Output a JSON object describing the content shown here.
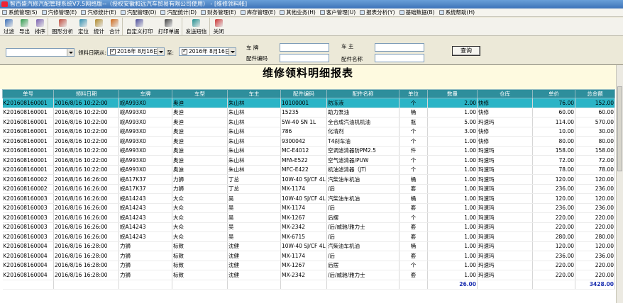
{
  "window": {
    "title": "智百盛汽修汽配管理系统V7.5网络版--（授权安徽和远汽车贸易有限公司使用） - [维修领料帐]"
  },
  "menu": [
    "系统管理(S)",
    "汽修管理(E)",
    "汽修统计(E)",
    "汽配管理(D)",
    "汽配统计(D)",
    "财务管理(E)",
    "库存管理(E)",
    "其他业务(H)",
    "客户管理(U)",
    "报表分析(Y)",
    "基础数据(B)",
    "系统帮助(H)"
  ],
  "toolbar": [
    {
      "label": "过滤",
      "icon": "filter-icon"
    },
    {
      "label": "导出",
      "icon": "export-icon"
    },
    {
      "label": "排序",
      "icon": "sort-icon"
    },
    {
      "label": "图形分析",
      "icon": "chart-icon"
    },
    {
      "label": "定位",
      "icon": "locate-icon"
    },
    {
      "label": "统计",
      "icon": "stats-icon"
    },
    {
      "label": "合计",
      "icon": "sum-icon"
    },
    {
      "label": "自定义打印",
      "icon": "custom-print-icon"
    },
    {
      "label": "打印单据",
      "icon": "print-icon"
    },
    {
      "label": "发送短信",
      "icon": "sms-icon"
    },
    {
      "label": "关闭",
      "icon": "close-icon"
    }
  ],
  "filter": {
    "combo1_value": "",
    "date_label_from": "领料日期从:",
    "date_from": "2016年 8月16日",
    "date_label_to": "至:",
    "date_to": "2016年 8月16日",
    "plate_label": "车  牌",
    "part_code_label": "配件编码",
    "owner_label": "车  主",
    "part_name_label": "配件名称",
    "query_button": "查询"
  },
  "report": {
    "title": "维修领料明细报表",
    "columns": [
      "单号",
      "领料日期",
      "车牌",
      "车型",
      "车主",
      "配件编码",
      "配件名称",
      "单位",
      "数量",
      "仓库",
      "单价",
      "总金额"
    ],
    "rows": [
      [
        "K201608160001",
        "2016/8/16  10:22:00",
        "皖A993X0",
        "奥迪",
        "朱山林",
        "10100001",
        "防冻液",
        "个",
        "2.00",
        "快修",
        "76.00",
        "152.00"
      ],
      [
        "K201608160001",
        "2016/8/16  10:22:00",
        "皖A993X0",
        "奥迪",
        "朱山林",
        "15235",
        "助力泵油",
        "桶",
        "1.00",
        "快修",
        "60.00",
        "60.00"
      ],
      [
        "K201608160001",
        "2016/8/16  10:22:00",
        "皖A993X0",
        "奥迪",
        "朱山林",
        "5W-40 SN 1L",
        "全合成汽油机机油",
        "瓶",
        "5.00",
        "玛速玛",
        "114.00",
        "570.00"
      ],
      [
        "K201608160001",
        "2016/8/16  10:22:00",
        "皖A993X0",
        "奥迪",
        "朱山林",
        "786",
        "化清剂",
        "个",
        "3.00",
        "快修",
        "10.00",
        "30.00"
      ],
      [
        "K201608160001",
        "2016/8/16  10:22:00",
        "皖A993X0",
        "奥迪",
        "朱山林",
        "9300042",
        "T4刹车油",
        "个",
        "1.00",
        "快修",
        "80.00",
        "80.00"
      ],
      [
        "K201608160001",
        "2016/8/16  10:22:00",
        "皖A993X0",
        "奥迪",
        "朱山林",
        "MC-E4012",
        "空调滤清器防PM2.5",
        "件",
        "1.00",
        "玛速玛",
        "158.00",
        "158.00"
      ],
      [
        "K201608160001",
        "2016/8/16  10:22:00",
        "皖A993X0",
        "奥迪",
        "朱山林",
        "MFA-E522",
        "空气滤清器/PUW",
        "个",
        "1.00",
        "玛速玛",
        "72.00",
        "72.00"
      ],
      [
        "K201608160001",
        "2016/8/16  10:22:00",
        "皖A993X0",
        "奥迪",
        "朱山林",
        "MFC-E422",
        "机油滤清器（JT）",
        "个",
        "1.00",
        "玛速玛",
        "78.00",
        "78.00"
      ],
      [
        "K201608160002",
        "2016/8/16  16:26:00",
        "皖A17K37",
        "力狮",
        "丁总",
        "10W-40 SJ/CF 4L",
        "汽柴油车机油",
        "桶",
        "1.00",
        "玛速玛",
        "120.00",
        "120.00"
      ],
      [
        "K201608160002",
        "2016/8/16  16:26:00",
        "皖A17K37",
        "力狮",
        "丁总",
        "MX-1174",
        "/后",
        "套",
        "1.00",
        "玛速玛",
        "236.00",
        "236.00"
      ],
      [
        "K201608160003",
        "2016/8/16  16:26:00",
        "皖A14243",
        "大众",
        "吴",
        "10W-40 SJ/CF 4L",
        "汽柴油车机油",
        "桶",
        "1.00",
        "玛速玛",
        "120.00",
        "120.00"
      ],
      [
        "K201608160003",
        "2016/8/16  16:26:00",
        "皖A14243",
        "大众",
        "吴",
        "MX-1174",
        "/后",
        "套",
        "1.00",
        "玛速玛",
        "236.00",
        "236.00"
      ],
      [
        "K201608160003",
        "2016/8/16  16:26:00",
        "皖A14243",
        "大众",
        "吴",
        "MX-1267",
        "后摆",
        "个",
        "1.00",
        "玛速玛",
        "220.00",
        "220.00"
      ],
      [
        "K201608160003",
        "2016/8/16  16:26:00",
        "皖A14243",
        "大众",
        "吴",
        "MX-2342",
        "/后/威驰/雅力士",
        "套",
        "1.00",
        "玛速玛",
        "220.00",
        "220.00"
      ],
      [
        "K201608160003",
        "2016/8/16  16:26:00",
        "皖A14243",
        "大众",
        "吴",
        "MX-6715",
        "/后",
        "套",
        "1.00",
        "玛速玛",
        "280.00",
        "280.00"
      ],
      [
        "K201608160004",
        "2016/8/16  16:28:00",
        "力狮",
        "标致",
        "沈健",
        "10W-40 SJ/CF 4L",
        "汽柴油车机油",
        "桶",
        "1.00",
        "玛速玛",
        "120.00",
        "120.00"
      ],
      [
        "K201608160004",
        "2016/8/16  16:28:00",
        "力狮",
        "标致",
        "沈健",
        "MX-1174",
        "/后",
        "套",
        "1.00",
        "玛速玛",
        "236.00",
        "236.00"
      ],
      [
        "K201608160004",
        "2016/8/16  16:28:00",
        "力狮",
        "标致",
        "沈健",
        "MX-1267",
        "后摆",
        "个",
        "1.00",
        "玛速玛",
        "220.00",
        "220.00"
      ],
      [
        "K201608160004",
        "2016/8/16  16:28:00",
        "力狮",
        "标致",
        "沈健",
        "MX-2342",
        "/后/威驰/雅力士",
        "套",
        "1.00",
        "玛速玛",
        "220.00",
        "220.00"
      ]
    ],
    "totals": {
      "quantity": "26.00",
      "amount": "3428.00"
    }
  },
  "colors": {
    "header": "#2e8e9c",
    "selected_row": "#2bb4c6",
    "title_bg": "#fefae0",
    "total_text": "#1b2fb0"
  }
}
